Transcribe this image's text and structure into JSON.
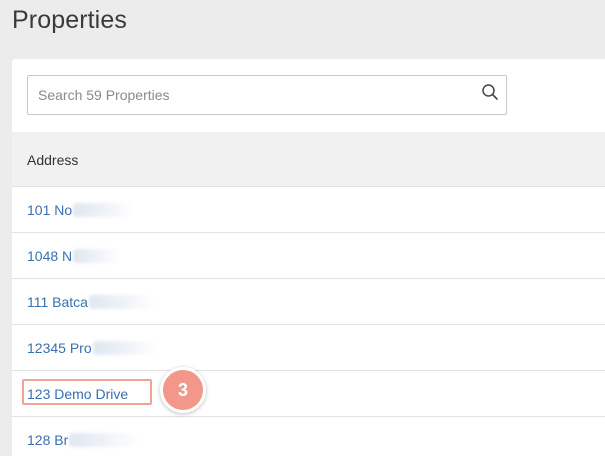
{
  "page": {
    "title": "Properties"
  },
  "search": {
    "placeholder": "Search 59 Properties",
    "value": ""
  },
  "table": {
    "columns": [
      "Address"
    ],
    "rows": [
      {
        "address": "101 No"
      },
      {
        "address": "1048 N"
      },
      {
        "address": "111 Batca"
      },
      {
        "address": "12345 Pro"
      },
      {
        "address": "123 Demo Drive"
      },
      {
        "address": "128 Br"
      }
    ]
  },
  "annotation": {
    "step_number": "3",
    "accent_color": "#f2978a"
  },
  "colors": {
    "link": "#3a6fb0",
    "header_bg": "#f1f1f1",
    "page_bg": "#ececec"
  }
}
